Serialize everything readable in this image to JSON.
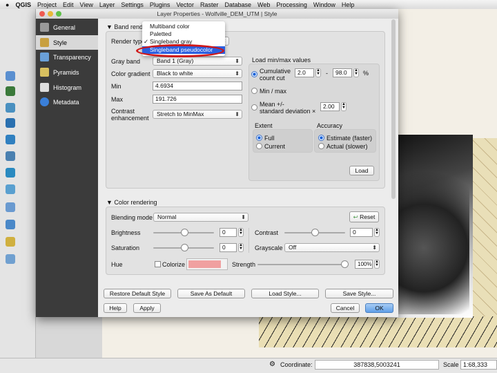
{
  "menubar": {
    "app": "QGIS",
    "items": [
      "Project",
      "Edit",
      "View",
      "Layer",
      "Settings",
      "Plugins",
      "Vector",
      "Raster",
      "Database",
      "Web",
      "Processing",
      "Window",
      "Help"
    ]
  },
  "dialog": {
    "title": "Layer Properties - Wolfville_DEM_UTM | Style"
  },
  "sidebar": {
    "items": [
      {
        "label": "General",
        "icon": "wrench-icon",
        "color": "#9a9a9a"
      },
      {
        "label": "Style",
        "icon": "paintbrush-icon",
        "color": "#c8a040",
        "selected": true
      },
      {
        "label": "Transparency",
        "icon": "transparency-icon",
        "color": "#6aa0d8"
      },
      {
        "label": "Pyramids",
        "icon": "pyramid-icon",
        "color": "#d8c060"
      },
      {
        "label": "Histogram",
        "icon": "histogram-icon",
        "color": "#dddddd"
      },
      {
        "label": "Metadata",
        "icon": "info-icon",
        "color": "#3a7fd8"
      }
    ]
  },
  "band": {
    "header": "Band rendering",
    "render_type_label": "Render type",
    "render_options": [
      {
        "label": "Multiband color"
      },
      {
        "label": "Paletted"
      },
      {
        "label": "Singleband gray",
        "checked": true
      },
      {
        "label": "Singleband pseudocolor",
        "highlighted": true
      }
    ],
    "check_mark": "✓",
    "gray_band_label": "Gray band",
    "gray_band": "Band 1 (Gray)",
    "gradient_label": "Color gradient",
    "gradient": "Black to white",
    "min_label": "Min",
    "min": "4.6934",
    "max_label": "Max",
    "max": "191.726",
    "contrast_label1": "Contrast",
    "contrast_label2": "enhancement",
    "contrast": "Stretch to MinMax"
  },
  "minmax": {
    "header": "Load min/max values",
    "cum_label1": "Cumulative",
    "cum_label2": "count cut",
    "cum_low": "2.0",
    "dash": "-",
    "cum_high": "98.0",
    "pct": "%",
    "minmax_label": "Min / max",
    "mean_label1": "Mean +/-",
    "mean_label2": "standard deviation ×",
    "mean_val": "2.00",
    "extent_header": "Extent",
    "extent_full": "Full",
    "extent_current": "Current",
    "accuracy_header": "Accuracy",
    "acc_estimate": "Estimate (faster)",
    "acc_actual": "Actual (slower)",
    "load_button": "Load",
    "selected_method": "Cumulative count cut",
    "selected_extent": "Full",
    "selected_accuracy": "Estimate (faster)"
  },
  "color": {
    "header": "Color rendering",
    "blend_label": "Blending mode",
    "blend": "Normal",
    "reset": "Reset",
    "brightness_label": "Brightness",
    "brightness": "0",
    "contrast_label": "Contrast",
    "contrast": "0",
    "saturation_label": "Saturation",
    "saturation": "0",
    "grayscale_label": "Grayscale",
    "grayscale": "Off",
    "hue_label": "Hue",
    "colorize_label": "Colorize",
    "colorize_color": "#f0a0a0",
    "strength_label": "Strength",
    "strength": "100%"
  },
  "buttons": {
    "restore": "Restore Default Style",
    "save_default": "Save As Default",
    "load_style": "Load Style...",
    "save_style": "Save Style...",
    "help": "Help",
    "apply": "Apply",
    "cancel": "Cancel",
    "ok": "OK"
  },
  "status": {
    "coordinate_label": "Coordinate:",
    "coordinate": "387838,5003241",
    "scale_label": "Scale",
    "scale": "1:68,333"
  }
}
